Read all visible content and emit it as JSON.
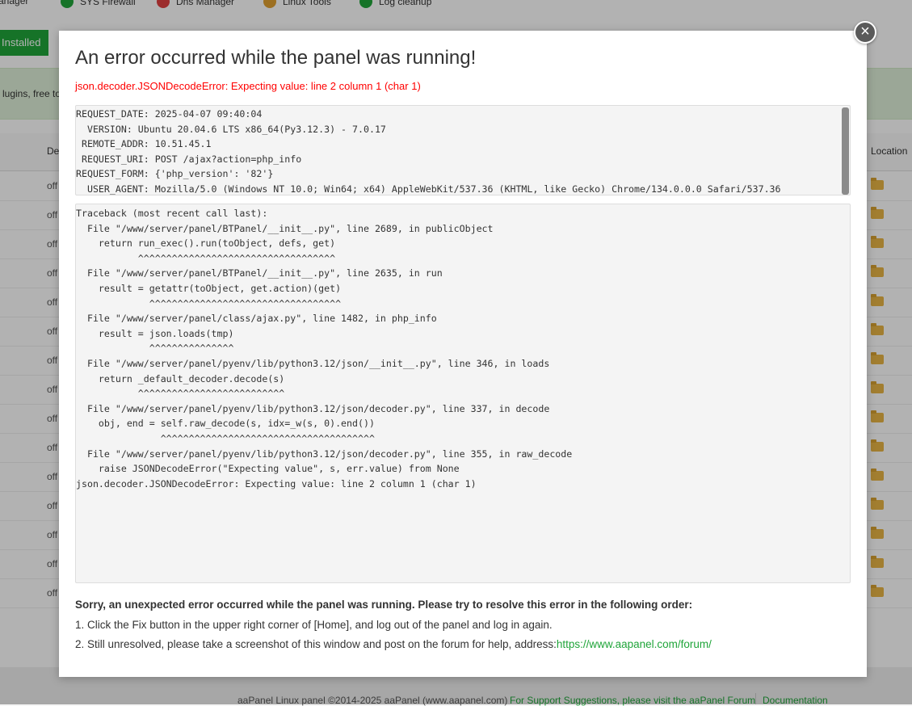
{
  "background": {
    "nav_items": [
      {
        "label": "anager",
        "icon": "manager-icon"
      },
      {
        "label": "SYS Firewall",
        "icon": "shield-icon"
      },
      {
        "label": "Dns Manager",
        "icon": "dns-icon"
      },
      {
        "label": "Linux Tools",
        "icon": "tools-icon"
      },
      {
        "label": "Log cleanup",
        "icon": "broom-icon"
      }
    ],
    "installed_label": "Installed",
    "banner_text": "lugins, free to",
    "table_header_partial": "De",
    "table_header_location": "Location",
    "row_status": "off",
    "footer_copyright": "aaPanel Linux panel ©2014-2025 aaPanel (www.aapanel.com)",
    "footer_support_link": "For Support Suggestions, please visit the aaPanel Forum",
    "footer_docs_link": "Documentation"
  },
  "dialog": {
    "close_label": "×",
    "title": "An error occurred while the panel was running!",
    "error_summary": "json.decoder.JSONDecodeError: Expecting value: line 2 column 1 (char 1)",
    "request_info": [
      "REQUEST_DATE: 2025-04-07 09:40:04",
      "  VERSION: Ubuntu 20.04.6 LTS x86_64(Py3.12.3) - 7.0.17",
      " REMOTE_ADDR: 10.51.45.1",
      " REQUEST_URI: POST /ajax?action=php_info",
      "REQUEST_FORM: {'php_version': '82'}",
      "  USER_AGENT: Mozilla/5.0 (Windows NT 10.0; Win64; x64) AppleWebKit/537.36 (KHTML, like Gecko) Chrome/134.0.0.0 Safari/537.36"
    ],
    "traceback": [
      "Traceback (most recent call last):",
      "  File \"/www/server/panel/BTPanel/__init__.py\", line 2689, in publicObject",
      "    return run_exec().run(toObject, defs, get)",
      "           ^^^^^^^^^^^^^^^^^^^^^^^^^^^^^^^^^^^",
      "  File \"/www/server/panel/BTPanel/__init__.py\", line 2635, in run",
      "    result = getattr(toObject, get.action)(get)",
      "             ^^^^^^^^^^^^^^^^^^^^^^^^^^^^^^^^^^",
      "  File \"/www/server/panel/class/ajax.py\", line 1482, in php_info",
      "    result = json.loads(tmp)",
      "             ^^^^^^^^^^^^^^^",
      "  File \"/www/server/panel/pyenv/lib/python3.12/json/__init__.py\", line 346, in loads",
      "    return _default_decoder.decode(s)",
      "           ^^^^^^^^^^^^^^^^^^^^^^^^^^",
      "  File \"/www/server/panel/pyenv/lib/python3.12/json/decoder.py\", line 337, in decode",
      "    obj, end = self.raw_decode(s, idx=_w(s, 0).end())",
      "               ^^^^^^^^^^^^^^^^^^^^^^^^^^^^^^^^^^^^^^",
      "  File \"/www/server/panel/pyenv/lib/python3.12/json/decoder.py\", line 355, in raw_decode",
      "    raise JSONDecodeError(\"Expecting value\", s, err.value) from None",
      "json.decoder.JSONDecodeError: Expecting value: line 2 column 1 (char 1)"
    ],
    "sorry_text": "Sorry, an unexpected error occurred while the panel was running. Please try to resolve this error in the following order:",
    "step1": "1. Click the Fix button in the upper right corner of [Home], and log out of the panel and log in again.",
    "step2_text": "2. Still unresolved, please take a screenshot of this window and post on the forum for help, address:",
    "forum_url": "https://www.aapanel.com/forum/"
  }
}
